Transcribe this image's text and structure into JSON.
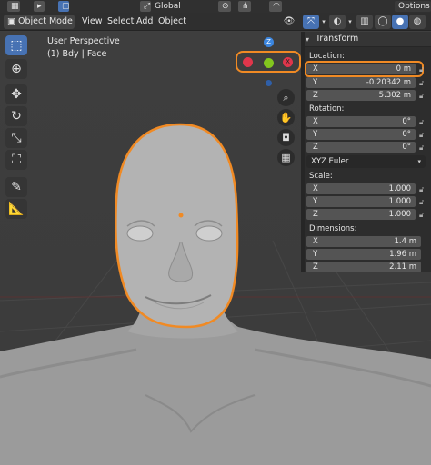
{
  "topbar": {
    "orientation_label": "Global",
    "options_label": "Options"
  },
  "header": {
    "mode_label": "Object Mode",
    "menus": [
      "View",
      "Select",
      "Add",
      "Object"
    ]
  },
  "viewport": {
    "title": "User Perspective",
    "subtitle": "(1) Bdy | Face"
  },
  "gizmo": {
    "z_label": "Z",
    "x_label": "X"
  },
  "npanel": {
    "section_title": "Transform",
    "location": {
      "label": "Location:",
      "x": {
        "axis": "X",
        "value": "0 m"
      },
      "y": {
        "axis": "Y",
        "value": "-0.20342 m"
      },
      "z": {
        "axis": "Z",
        "value": "5.302 m"
      }
    },
    "rotation": {
      "label": "Rotation:",
      "x": {
        "axis": "X",
        "value": "0°"
      },
      "y": {
        "axis": "Y",
        "value": "0°"
      },
      "z": {
        "axis": "Z",
        "value": "0°"
      }
    },
    "rotation_mode": "XYZ Euler",
    "scale": {
      "label": "Scale:",
      "x": {
        "axis": "X",
        "value": "1.000"
      },
      "y": {
        "axis": "Y",
        "value": "1.000"
      },
      "z": {
        "axis": "Z",
        "value": "1.000"
      }
    },
    "dimensions": {
      "label": "Dimensions:",
      "x": {
        "axis": "X",
        "value": "1.4 m"
      },
      "y": {
        "axis": "Y",
        "value": "1.96 m"
      },
      "z": {
        "axis": "Z",
        "value": "2.11 m"
      }
    }
  },
  "colors": {
    "accent": "#4772b3",
    "selection_outline": "#f08a24",
    "axis_x": "#e0364b",
    "axis_y": "#83c61e",
    "axis_z": "#3b86e0"
  }
}
